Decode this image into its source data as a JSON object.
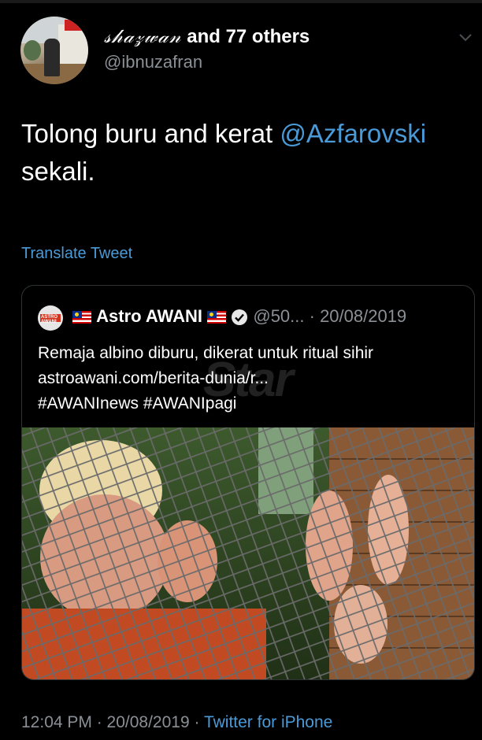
{
  "tweet": {
    "author_name_stylized": "𝓈𝒽𝒶𝓏𝓌𝒶𝓃",
    "author_name_suffix": " and 77 others",
    "author_handle": "@ibnuzafran",
    "text_part1": "Tolong buru and kerat ",
    "mention": "@Azfarovski",
    "text_part2": "sekali.",
    "translate_label": "Translate Tweet",
    "timestamp": "12:04 PM · 20/08/2019 · ",
    "source_label": "Twitter for iPhone"
  },
  "quoted_tweet": {
    "avatar_text": "ASTRO AWANI",
    "name": "Astro AWANI",
    "handle": "@50...",
    "date": "· 20/08/2019",
    "line1": "Remaja albino diburu, dikerat untuk ritual sihir",
    "line2": "astroawani.com/berita-dunia/r...",
    "line3": "#AWANInews #AWANIpagi",
    "watermark": "Star"
  },
  "icons": {
    "menu_caret": "chevron-down-icon",
    "verified": "verified-badge-icon",
    "flag": "malaysia-flag-icon"
  },
  "colors": {
    "background": "#000000",
    "link": "#4b9ad8",
    "muted": "#8a9096"
  }
}
